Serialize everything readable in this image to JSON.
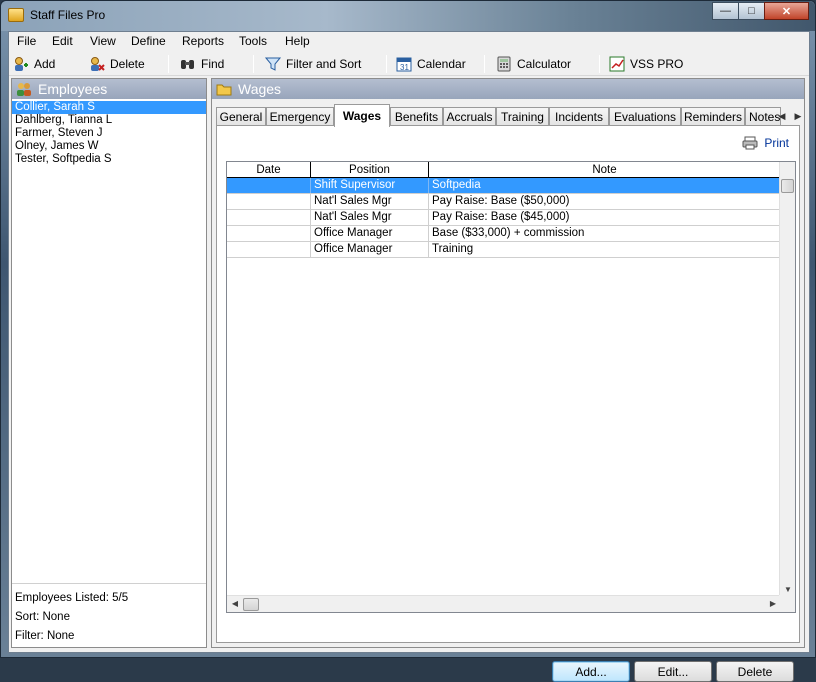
{
  "window": {
    "title": "Staff Files Pro",
    "minimize": "—",
    "maximize": "□",
    "close": "✕"
  },
  "menu": [
    "File",
    "Edit",
    "View",
    "Define",
    "Reports",
    "Tools",
    "Help"
  ],
  "toolbar": {
    "add": "Add",
    "delete": "Delete",
    "find": "Find",
    "filter_sort": "Filter and Sort",
    "calendar": "Calendar",
    "calculator": "Calculator",
    "vss": "VSS PRO"
  },
  "employees": {
    "header": "Employees",
    "items": [
      "Collier, Sarah S",
      "Dahlberg, Tianna L",
      "Farmer, Steven J",
      "Olney, James W",
      "Tester, Softpedia S"
    ],
    "listed": "Employees Listed: 5/5",
    "sort": "Sort: None",
    "filter": "Filter: None"
  },
  "wages_panel": {
    "header": "Wages",
    "tabs": [
      "General",
      "Emergency",
      "Wages",
      "Benefits",
      "Accruals",
      "Training",
      "Incidents",
      "Evaluations",
      "Reminders",
      "Notes"
    ],
    "print": "Print",
    "columns": [
      "Date",
      "Position",
      "Note"
    ],
    "rows": [
      {
        "date": "",
        "position": "Shift Supervisor",
        "note": "Softpedia"
      },
      {
        "date": "",
        "position": "Nat'l Sales Mgr",
        "note": "Pay Raise: Base ($50,000)"
      },
      {
        "date": "",
        "position": "Nat'l Sales Mgr",
        "note": "Pay Raise: Base ($45,000)"
      },
      {
        "date": "",
        "position": "Office Manager",
        "note": "Base ($33,000) + commission"
      },
      {
        "date": "",
        "position": "Office Manager",
        "note": "Training"
      }
    ],
    "buttons": {
      "add": "Add...",
      "edit": "Edit...",
      "delete": "Delete"
    }
  },
  "colors": {
    "selection": "#3399ff",
    "panel_header": "#98a5bb"
  }
}
